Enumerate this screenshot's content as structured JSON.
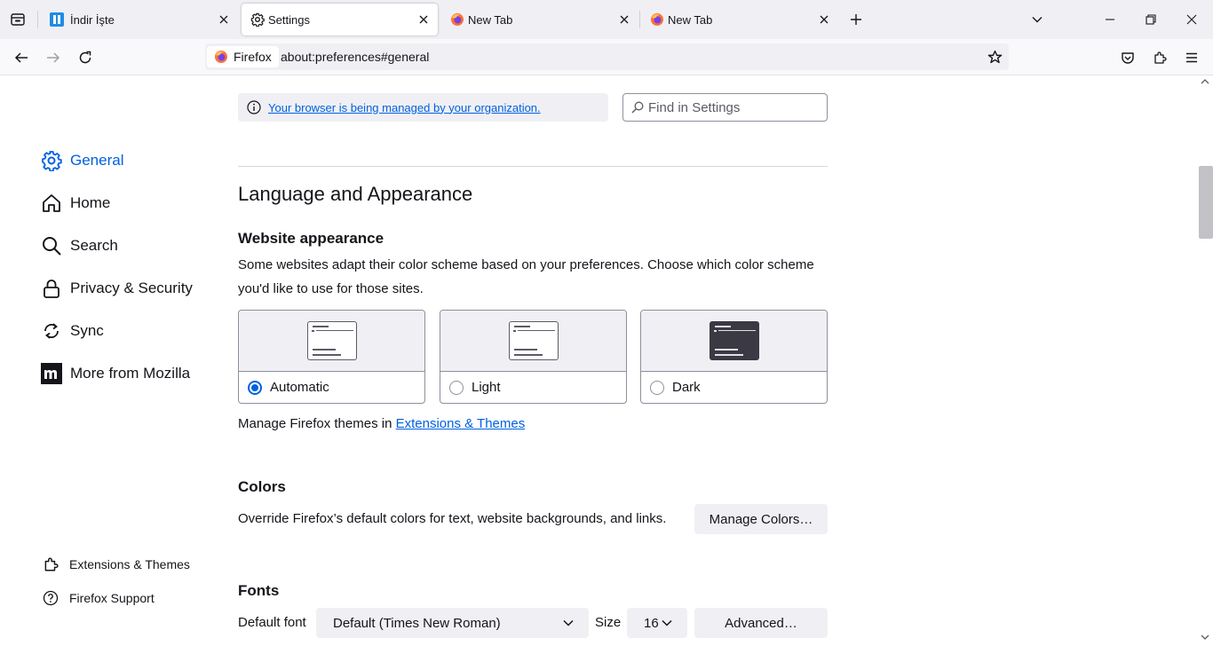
{
  "tabs": [
    {
      "title": "İndir İşte",
      "icon": "site-favicon-icon",
      "active": false
    },
    {
      "title": "Settings",
      "icon": "gear-icon",
      "active": true
    },
    {
      "title": "New Tab",
      "icon": "firefox-icon",
      "active": false
    },
    {
      "title": "New Tab",
      "icon": "firefox-icon",
      "active": false
    }
  ],
  "urlbar": {
    "identity_label": "Firefox",
    "url": "about:preferences#general"
  },
  "sidebar": {
    "items": [
      {
        "label": "General",
        "icon": "gear-icon",
        "selected": true
      },
      {
        "label": "Home",
        "icon": "home-icon"
      },
      {
        "label": "Search",
        "icon": "search-icon"
      },
      {
        "label": "Privacy & Security",
        "icon": "lock-icon"
      },
      {
        "label": "Sync",
        "icon": "sync-icon"
      },
      {
        "label": "More from Mozilla",
        "icon": "mozilla-icon"
      }
    ],
    "footer": [
      {
        "label": "Extensions & Themes",
        "icon": "puzzle-icon"
      },
      {
        "label": "Firefox Support",
        "icon": "help-icon"
      }
    ]
  },
  "main": {
    "policy_link": "Your browser is being managed by your organization.",
    "find_placeholder": "Find in Settings",
    "section_title": "Language and Appearance",
    "website_appearance": {
      "heading": "Website appearance",
      "description": "Some websites adapt their color scheme based on your preferences. Choose which color scheme you'd like to use for those sites.",
      "options": [
        {
          "label": "Automatic",
          "selected": true
        },
        {
          "label": "Light",
          "selected": false
        },
        {
          "label": "Dark",
          "selected": false
        }
      ],
      "themes_prefix": "Manage Firefox themes in ",
      "themes_link": "Extensions & Themes"
    },
    "colors": {
      "heading": "Colors",
      "description": "Override Firefox’s default colors for text, website backgrounds, and links.",
      "button": "Manage Colors…"
    },
    "fonts": {
      "heading": "Fonts",
      "default_font_label": "Default font",
      "default_font_value": "Default (Times New Roman)",
      "size_label": "Size",
      "size_value": "16",
      "advanced_button": "Advanced…"
    }
  },
  "colors": {
    "accent": "#0061e0",
    "toolbar": "#f9f9fb",
    "tabstrip": "#f0f0f4"
  }
}
